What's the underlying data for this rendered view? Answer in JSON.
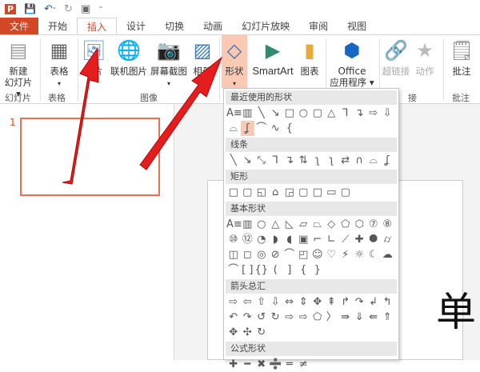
{
  "qat": {
    "app_icon": "P",
    "save": "💾",
    "undo": "↶·",
    "redo": "↻",
    "present": "▣",
    "more": "⁼"
  },
  "tabs": [
    "文件",
    "开始",
    "插入",
    "设计",
    "切换",
    "动画",
    "幻灯片放映",
    "审阅",
    "视图"
  ],
  "ribbon": {
    "new_slide": [
      "新建",
      "幻灯片 ▾"
    ],
    "table": [
      "表格",
      "▾"
    ],
    "picture": "图片",
    "online_picture": "联机图片",
    "screenshot": [
      "屏幕截图",
      "▾"
    ],
    "album": [
      "相册",
      "▾"
    ],
    "shapes": [
      "形状",
      "▾"
    ],
    "smartart": "SmartArt",
    "chart": "图表",
    "office_apps": [
      "Office",
      "应用程序 ▾"
    ],
    "hyperlink": "超链接",
    "action": "动作",
    "comment": "批注",
    "groups": [
      "幻灯片",
      "表格",
      "图像",
      "接",
      "批注"
    ]
  },
  "slides": {
    "number": "1"
  },
  "main": {
    "big_char": "单"
  },
  "dropdown": {
    "sections": [
      {
        "title": "最近使用的形状",
        "rows": [
          [
            "A≡",
            "▥",
            "╲",
            "↘",
            "□",
            "○",
            "▢",
            "△",
            "⅂",
            "↴",
            "⇨",
            "⇩"
          ],
          [
            "⌓",
            "ʆ",
            "⌒",
            "∿",
            "{"
          ]
        ]
      },
      {
        "title": "线条",
        "rows": [
          [
            "╲",
            "↘",
            "⤡",
            "⅂",
            "↴",
            "⇅",
            "ʅ",
            "ʅ",
            "⇄",
            "∩",
            "⌓",
            "ʆ"
          ]
        ]
      },
      {
        "title": "矩形",
        "rows": [
          [
            "□",
            "▢",
            "◱",
            "⌂",
            "◲",
            "▢",
            "□",
            "▭",
            "▢"
          ]
        ]
      },
      {
        "title": "基本形状",
        "rows": [
          [
            "A≡",
            "▥",
            "○",
            "△",
            "◺",
            "▱",
            "⏢",
            "◇",
            "⬠",
            "⬡",
            "⑦",
            "⑧"
          ],
          [
            "⑩",
            "⑫",
            "◔",
            "◗",
            "◖",
            "▣",
            "⌐",
            "∟",
            "⟋",
            "✚",
            "⯃",
            "⌭"
          ],
          [
            "◫",
            "◻",
            "◎",
            "⊘",
            "⌒",
            "◰",
            "☺",
            "♡",
            "⚡",
            "☼",
            "☾",
            "☁"
          ],
          [
            "⌒",
            "[ ]",
            "{}",
            "(",
            "]",
            "{",
            "}"
          ]
        ]
      },
      {
        "title": "箭头总汇",
        "rows": [
          [
            "⇨",
            "⇦",
            "⇧",
            "⇩",
            "⇔",
            "⇕",
            "✥",
            "⇞",
            "↱",
            "↷",
            "↲",
            "↰"
          ],
          [
            "↶",
            "↷",
            "↺",
            "↻",
            "⇨",
            "⇨",
            "⬠",
            "〉",
            "⇛",
            "⇓",
            "⇚",
            "⇑"
          ],
          [
            "✥",
            "✣",
            "↻"
          ]
        ]
      },
      {
        "title": "公式形状",
        "rows": [
          [
            "✚",
            "━",
            "✖",
            "➗",
            "═",
            "≠"
          ]
        ]
      }
    ]
  }
}
